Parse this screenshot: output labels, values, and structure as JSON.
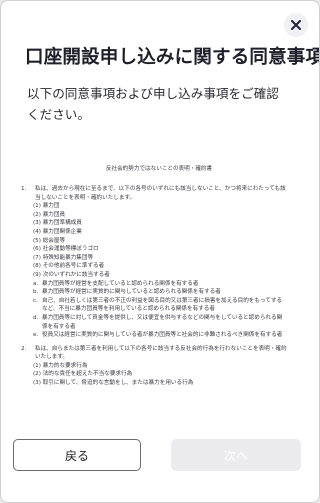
{
  "header": {
    "close_icon": "close-x-icon",
    "title": "口座開設申し込みに関する同意事項",
    "subtitle": "以下の同意事項および申し込み事項をご確認ください。"
  },
  "document": {
    "title": "反社会的勢力ではないことの表明・確約書",
    "section1": {
      "num": "1.",
      "text": "私は、過去から現在に至るまで、以下の各号のいずれにも該当しないこと、かつ将来にわたっても該当しないことを表明・確約いたします。",
      "items": [
        "(1) 暴力団",
        "(2) 暴力団員",
        "(3) 暴力団準構成員",
        "(4) 暴力団関係企業",
        "(5) 総会屋等",
        "(6) 社会運動等標ぼうゴロ",
        "(7) 特殊知能暴力集団等",
        "(8) その他前各号に準ずる者",
        "(9) 次のいずれかに該当する者"
      ],
      "subitems": [
        {
          "mark": "a.",
          "text": "暴力団員等が経営を支配していると認められる関係を有する者"
        },
        {
          "mark": "b.",
          "text": "暴力団員等が経営に実質的に関与していると認められる関係を有する者"
        },
        {
          "mark": "c.",
          "text": "自己、自社若しくは第三者の不正の利益を図る目的又は第三者に損害を加える目的をもってするなど、不当に暴力団員等を利用していると認められる関係を有する者"
        },
        {
          "mark": "d.",
          "text": "暴力団員等に対して資金等を提供し、又は便宜を供与するなどの関与をしていると認められる関係を有する者"
        },
        {
          "mark": "e.",
          "text": "役員又は経営に実質的に関与している者が暴力団員等と社会的に非難されるべき関係を有する者"
        }
      ]
    },
    "section2": {
      "num": "2.",
      "text": "私は、自らまたは第三者を利用して以下の各号に該当する反社会的行為を行わないことを表明・確約いたします。",
      "items": [
        "(1) 暴力的な要求行為",
        "(2) 法的な責任を超えた不当な要求行為",
        "(3) 取引に関して、脅迫的な言動をし、または暴力を用いる行為"
      ]
    }
  },
  "footer": {
    "back_label": "戻る",
    "next_label": "次へ"
  },
  "colors": {
    "primary_text": "#1f1f2a",
    "disabled_button": "#ececef",
    "close_bg": "#f0f0f5"
  }
}
